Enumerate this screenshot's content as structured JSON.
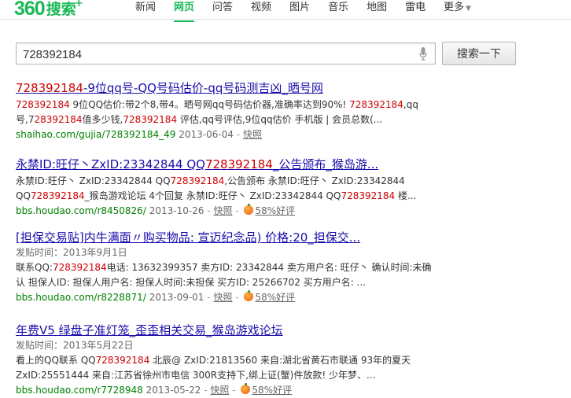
{
  "header": {
    "logo": {
      "number": "360",
      "word": "搜索",
      "plus": "+"
    },
    "nav": [
      "新闻",
      "网页",
      "问答",
      "视频",
      "图片",
      "音乐",
      "地图",
      "雷电",
      "更多"
    ],
    "active_nav": "网页"
  },
  "search": {
    "query": "728392184",
    "button_label": "搜索一下"
  },
  "results": [
    {
      "title": [
        [
          "728392184",
          true
        ],
        [
          "-9位qq号-QQ号码估价-qq号码测吉凶_晒号网",
          false
        ]
      ],
      "desc": [
        [
          "728392184",
          true
        ],
        [
          " 9位QQ估价:带2个8,带4。晒号网qq号码估价器,准确率达到90%! ",
          false
        ],
        [
          "728392184",
          true
        ],
        [
          ",qq号,7",
          false
        ],
        [
          "28392184",
          true
        ],
        [
          "值多少钱,",
          false
        ],
        [
          "728392184",
          true
        ],
        [
          " 评估,qq号评估,9位qq估价 手机版 | 会员总数(...",
          false
        ]
      ],
      "date_line": "",
      "url": "shaihao.com/gujia/728392184_49",
      "date": "2013-06-04",
      "cache": "快照",
      "rating": ""
    },
    {
      "title": [
        [
          "永禁ID:旺仔丶ZxID:23342844 QQ",
          false
        ],
        [
          "728392184",
          true
        ],
        [
          "_公告颁布_猴岛游...",
          false
        ]
      ],
      "desc": [
        [
          "永禁ID:旺仔丶 ZxID:23342844 QQ",
          false
        ],
        [
          "728392184",
          true
        ],
        [
          ",公告颁布 永禁ID:旺仔丶 ZxID:23342844 QQ",
          false
        ],
        [
          "728",
          true
        ],
        [
          "392184",
          true
        ],
        [
          "_猴岛游戏论坛 4个回复 永禁ID:旺仔丶 ZxID:23342844 QQ",
          false
        ],
        [
          "728392184",
          true
        ],
        [
          " 楼...",
          false
        ]
      ],
      "date_line": "",
      "url": "bbs.houdao.com/r8450826/",
      "date": "2013-10-26",
      "cache": "快照",
      "rating": "58%好评"
    },
    {
      "title": [
        [
          "[担保交易贴]内牛满面〃购买物品: 宣迈纪念品) 价格:20_担保交...",
          false
        ]
      ],
      "desc": [
        [
          "联系QQ:",
          false
        ],
        [
          "728392184",
          true
        ],
        [
          "电话: 13632399357 卖方ID: 23342844 卖方用户名: 旺仔丶 确认时间:未确认 担保人ID: 担保人用户名: 担保人时间:未担保 买方ID: 25266702 买方用户名: ...",
          false
        ]
      ],
      "date_line": "发贴时间：2013年9月1日",
      "url": "bbs.houdao.com/r8228871/",
      "date": "2013-09-01",
      "cache": "快照",
      "rating": "58%好评"
    },
    {
      "title": [
        [
          "年费V5 绿盘子准灯笼_歪歪相关交易_猴岛游戏论坛",
          false
        ]
      ],
      "desc": [
        [
          "看上的QQ联系 QQ",
          false
        ],
        [
          "728392184",
          true
        ],
        [
          " 北辰@ ZxID:21813560 来自:湖北省黄石市联通 93年的夏天 ZxID:25551444 来自:江苏省徐州市电信 300R支持下,绑上证(蟹)件放款! 少年梦、...",
          false
        ]
      ],
      "date_line": "发贴时间：2013年5月22日",
      "url": "bbs.houdao.com/r7728948",
      "date": "2013-05-22",
      "cache": "快照",
      "rating": "58%好评"
    }
  ]
}
